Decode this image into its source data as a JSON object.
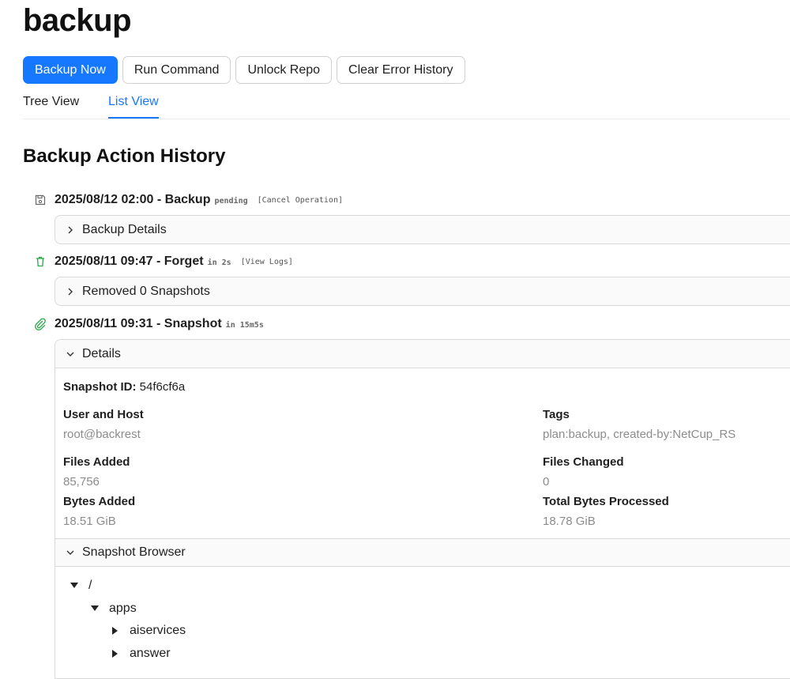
{
  "page": {
    "title": "backup"
  },
  "toolbar": {
    "backup_now": "Backup Now",
    "run_command": "Run Command",
    "unlock_repo": "Unlock Repo",
    "clear_error_history": "Clear Error History",
    "accent": "#1677ff"
  },
  "tabs": [
    {
      "label": "Tree View",
      "active": false
    },
    {
      "label": "List View",
      "active": true
    }
  ],
  "history": {
    "title": "Backup Action History",
    "operations": [
      {
        "icon": "save-icon",
        "title": "2025/08/12 02:00 - Backup",
        "status": "pending",
        "link": "[Cancel Operation]",
        "collapse_label": "Backup Details"
      },
      {
        "icon": "trash-icon",
        "icon_color": "#28a745",
        "title": "2025/08/11 09:47 - Forget",
        "status": "in 2s",
        "link": "[View Logs]",
        "collapse_label": "Removed 0 Snapshots"
      },
      {
        "icon": "paperclip-icon",
        "icon_color": "#28a745",
        "title": "2025/08/11 09:31 - Snapshot",
        "status": "in 15m5s",
        "details_label": "Details",
        "snapshot_id_label": "Snapshot ID:",
        "snapshot_id": "54f6cf6a",
        "fields": {
          "user_host": {
            "label": "User and Host",
            "value": "root@backrest"
          },
          "tags": {
            "label": "Tags",
            "value": "plan:backup, created-by:NetCup_RS"
          },
          "files_added": {
            "label": "Files Added",
            "value": "85,756"
          },
          "files_changed": {
            "label": "Files Changed",
            "value": "0"
          },
          "bytes_added": {
            "label": "Bytes Added",
            "value": "18.51 GiB"
          },
          "total_bytes": {
            "label": "Total Bytes Processed",
            "value": "18.78 GiB"
          }
        },
        "browser_label": "Snapshot Browser",
        "tree": {
          "root": "/",
          "apps": "apps",
          "children": [
            "aiservices",
            "answer"
          ]
        }
      }
    ]
  }
}
